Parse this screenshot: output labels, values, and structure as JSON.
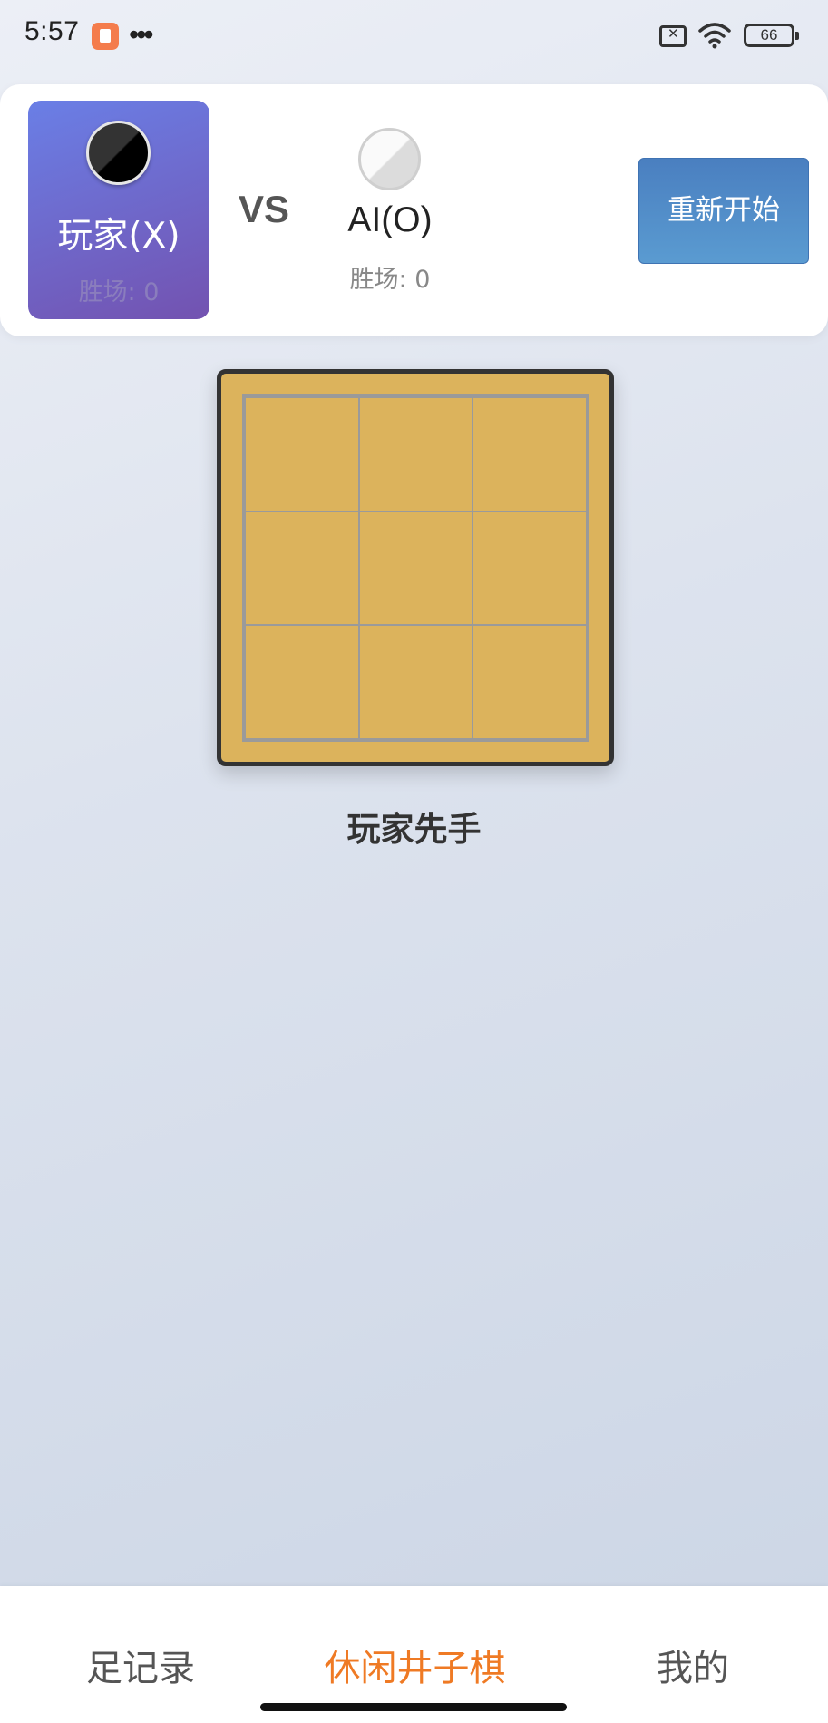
{
  "status_bar": {
    "time": "5:57",
    "more": "•••",
    "battery": "66"
  },
  "header": {
    "player": {
      "label": "玩家(X)",
      "wins": "胜场: 0"
    },
    "vs": "VS",
    "ai": {
      "label": "AI(O)",
      "wins": "胜场: 0"
    },
    "restart_label": "重新开始"
  },
  "board": {
    "cells": [
      "",
      "",
      "",
      "",
      "",
      "",
      "",
      "",
      ""
    ]
  },
  "turn_status": "玩家先手",
  "bottom_nav": {
    "items": [
      {
        "label": "足记录",
        "active": false
      },
      {
        "label": "休闲井子棋",
        "active": true
      },
      {
        "label": "我的",
        "active": false
      }
    ]
  },
  "colors": {
    "accent": "#ef7a24",
    "board": "#dcb35c",
    "restart_button": "#4a7fc0"
  }
}
